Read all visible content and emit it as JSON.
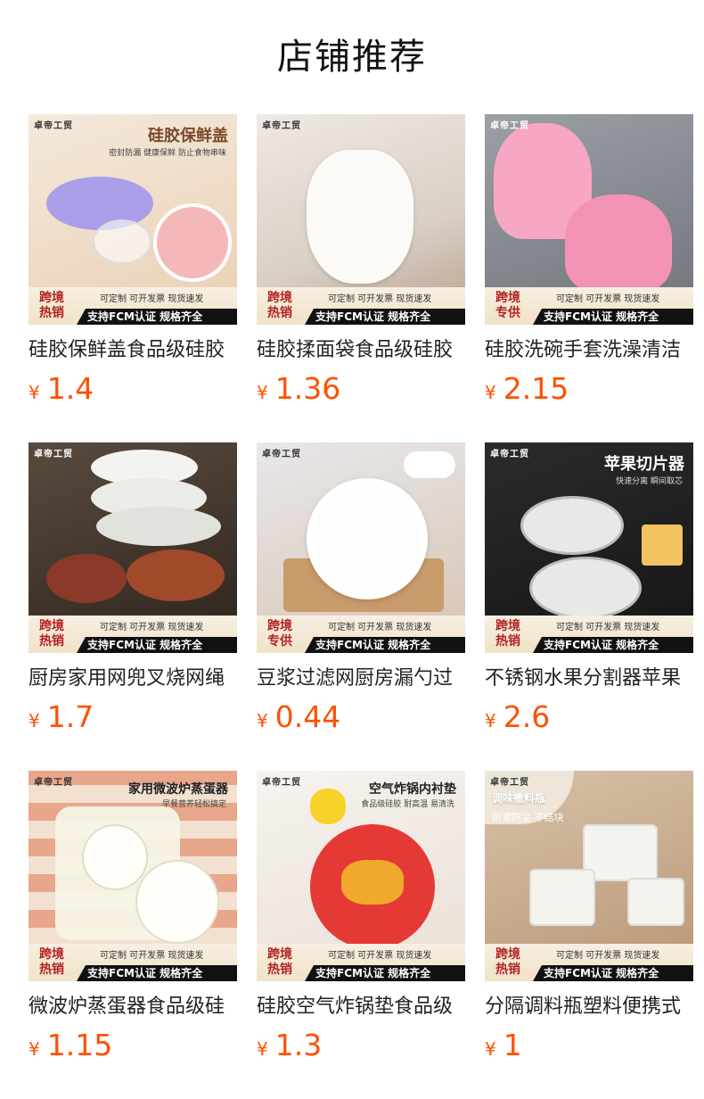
{
  "page": {
    "title": "店铺推荐"
  },
  "currency_symbol": "¥",
  "products": [
    {
      "brand": "卓帝工贸",
      "overlay_title": "硅胶保鲜盖",
      "overlay_sub": "密封防漏 健康保鲜 防止食物串味",
      "badge_left": "跨境热销",
      "badge_top": "可定制 可开发票 现货速发",
      "badge_bottom": "支持FCM认证 规格齐全",
      "title": "硅胶保鲜盖食品级硅胶",
      "price": "1.4"
    },
    {
      "brand": "卓帝工贸",
      "overlay_title": "",
      "overlay_sub": "",
      "badge_left": "跨境热销",
      "badge_top": "可定制 可开发票 现货速发",
      "badge_bottom": "支持FCM认证 规格齐全",
      "title": "硅胶揉面袋食品级硅胶",
      "price": "1.36"
    },
    {
      "brand": "卓帝工贸",
      "overlay_title": "",
      "overlay_sub": "",
      "badge_left": "跨境专供",
      "badge_top": "可定制 可开发票 现货速发",
      "badge_bottom": "支持FCM认证 规格齐全",
      "title": "硅胶洗碗手套洗澡清洁",
      "price": "2.15"
    },
    {
      "brand": "卓帝工贸",
      "overlay_title": "",
      "overlay_sub": "",
      "badge_left": "跨境热销",
      "badge_top": "可定制 可开发票 现货速发",
      "badge_bottom": "支持FCM认证 规格齐全",
      "title": "厨房家用网兜叉烧网绳",
      "price": "1.7"
    },
    {
      "brand": "卓帝工贸",
      "overlay_title": "",
      "overlay_sub": "",
      "badge_left": "跨境专供",
      "badge_top": "可定制 可开发票 现货速发",
      "badge_bottom": "支持FCM认证 规格齐全",
      "title": "豆浆过滤网厨房漏勺过",
      "price": "0.44"
    },
    {
      "brand": "卓帝工贸",
      "overlay_title": "苹果切片器",
      "overlay_sub": "快速分离 瞬间取芯",
      "badge_left": "跨境热销",
      "badge_top": "可定制 可开发票 现货速发",
      "badge_bottom": "支持FCM认证 规格齐全",
      "title": "不锈钢水果分割器苹果",
      "price": "2.6"
    },
    {
      "brand": "卓帝工贸",
      "overlay_title": "家用微波炉蒸蛋器",
      "overlay_sub": "早餐营养轻松搞定",
      "badge_left": "跨境热销",
      "badge_top": "可定制 可开发票 现货速发",
      "badge_bottom": "支持FCM认证 规格齐全",
      "title": "微波炉蒸蛋器食品级硅",
      "price": "1.15"
    },
    {
      "brand": "卓帝工贸",
      "overlay_title": "空气炸锅内衬垫",
      "overlay_sub": "食品级硅胶 耐高温 易清洗",
      "badge_left": "跨境热销",
      "badge_top": "可定制 可开发票 现货速发",
      "badge_bottom": "支持FCM认证 规格齐全",
      "title": "硅胶空气炸锅垫食品级",
      "price": "1.3"
    },
    {
      "brand": "卓帝工贸",
      "overlay_title": "调味撒料瓶",
      "overlay_sub": "防潮防尘 不结块",
      "badge_left": "跨境热销",
      "badge_top": "可定制 可开发票 现货速发",
      "badge_bottom": "支持FCM认证 规格齐全",
      "title": "分隔调料瓶塑料便携式",
      "price": "1"
    }
  ]
}
